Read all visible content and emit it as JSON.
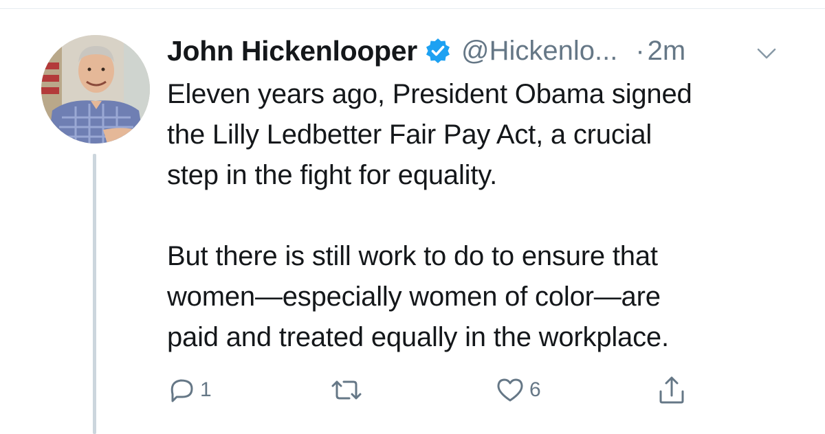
{
  "tweet": {
    "author_name": "John Hickenlooper",
    "handle": "@Hickenlo...",
    "separator": "·",
    "time": "2m",
    "verified": true,
    "paragraphs": [
      [
        "Eleven years ago, President Obama signed",
        "the Lilly Ledbetter Fair Pay Act, a crucial",
        "step in the fight for equality."
      ],
      [
        "But there is still work to do to ensure that",
        "women—especially women of color—are",
        "paid and treated equally in the workplace."
      ]
    ],
    "actions": {
      "reply_count": "1",
      "retweet_count": "",
      "like_count": "6"
    }
  },
  "icons": {
    "verified": "verified-badge-icon",
    "caret": "chevron-down-icon",
    "reply": "reply-icon",
    "retweet": "retweet-icon",
    "like": "heart-icon",
    "share": "share-icon"
  },
  "colors": {
    "text": "#14171a",
    "secondary": "#657786",
    "verified_blue": "#1da1f2",
    "thread_line": "#ccd6dd"
  }
}
